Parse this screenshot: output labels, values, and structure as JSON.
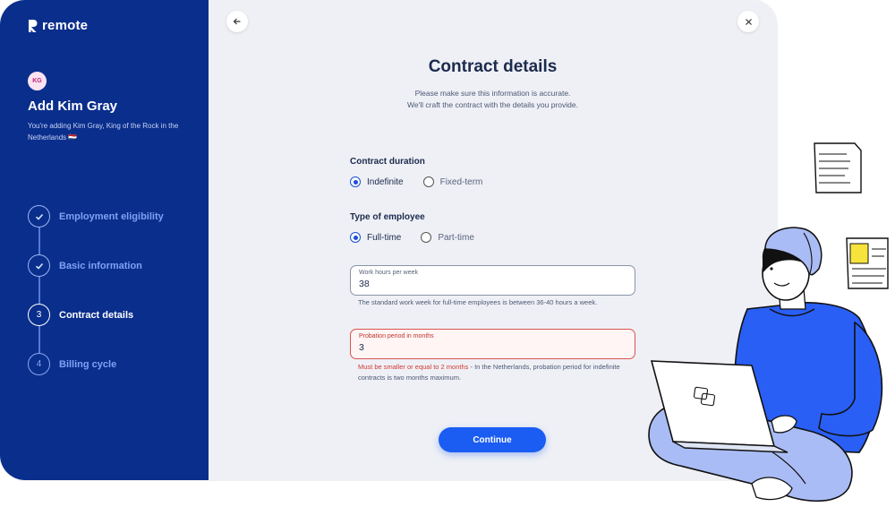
{
  "brand": {
    "name": "remote"
  },
  "sidebar": {
    "avatar_initials": "KG",
    "title": "Add Kim Gray",
    "description": "You're adding Kim Gray, King of the Rock in the Netherlands 🇳🇱",
    "steps": [
      {
        "number": "1",
        "label": "Employment eligibility",
        "status": "done"
      },
      {
        "number": "2",
        "label": "Basic information",
        "status": "done"
      },
      {
        "number": "3",
        "label": "Contract details",
        "status": "active"
      },
      {
        "number": "4",
        "label": "Billing cycle",
        "status": "pending"
      }
    ]
  },
  "main": {
    "back_icon": "arrow-left-icon",
    "close_icon": "close-icon",
    "heading": "Contract details",
    "subtitle_line1": "Please make sure this information is accurate.",
    "subtitle_line2": "We'll craft the contract with the details you provide.",
    "contract_duration": {
      "label": "Contract duration",
      "options": [
        "Indefinite",
        "Fixed-term"
      ],
      "selected": "Indefinite"
    },
    "employee_type": {
      "label": "Type of employee",
      "options": [
        "Full-time",
        "Part-time"
      ],
      "selected": "Full-time"
    },
    "work_hours": {
      "label": "Work hours per week",
      "value": "38",
      "help": "The standard work week for full-time employees is between 36-40 hours a week."
    },
    "probation": {
      "label": "Probation period in months",
      "value": "3",
      "error": "Must be smaller or equal to 2 months",
      "help": " - In the Netherlands, probation period for indefinite contracts is two months maximum."
    },
    "continue_label": "Continue"
  },
  "colors": {
    "sidebar_bg": "#0a2e8c",
    "main_bg": "#eef0f5",
    "accent": "#1b5cf2",
    "error": "#d23a34"
  }
}
